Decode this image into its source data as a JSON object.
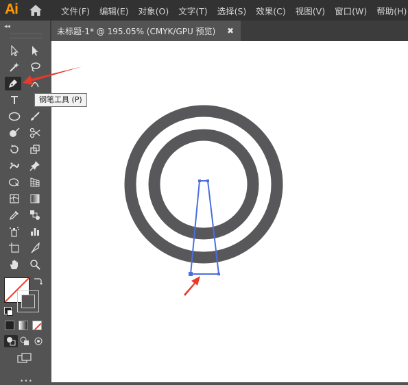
{
  "app": {
    "logo": "Ai"
  },
  "menu": {
    "items": [
      "文件(F)",
      "编辑(E)",
      "对象(O)",
      "文字(T)",
      "选择(S)",
      "效果(C)",
      "视图(V)",
      "窗口(W)",
      "帮助(H)"
    ]
  },
  "document_tab": {
    "title": "未标题-1* @ 195.05% (CMYK/GPU 预览)",
    "close": "✖"
  },
  "toolbar": {
    "collapse": "◂◂",
    "tooltip": "钢笔工具 (P)",
    "active_tool": "pen-tool",
    "fill_color": "#ffffff",
    "stroke_color": "#222222"
  },
  "artwork": {
    "ring_color": "#58585a",
    "path_color": "#4a6ee0",
    "arrow_color": "#e8392b"
  }
}
